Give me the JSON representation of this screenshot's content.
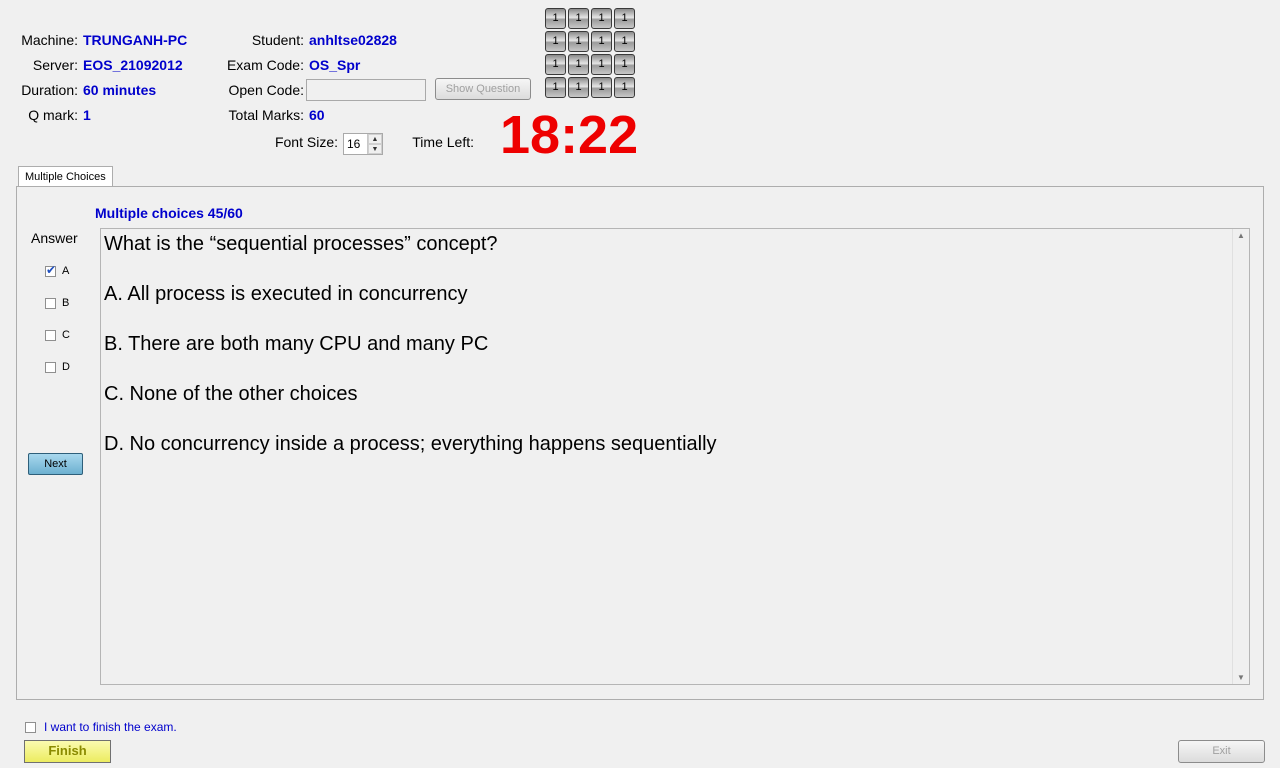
{
  "header": {
    "machine_label": "Machine:",
    "machine_value": "TRUNGANH-PC",
    "server_label": "Server:",
    "server_value": "EOS_21092012",
    "duration_label": "Duration:",
    "duration_value": "60 minutes",
    "qmark_label": "Q mark:",
    "qmark_value": "1",
    "student_label": "Student:",
    "student_value": "anhltse02828",
    "exam_code_label": "Exam Code:",
    "exam_code_value": "OS_Spr",
    "open_code_label": "Open Code:",
    "open_code_value": "",
    "show_question_label": "Show Question",
    "total_marks_label": "Total Marks:",
    "total_marks_value": "60",
    "font_size_label": "Font Size:",
    "font_size_value": "16",
    "time_left_label": "Time Left:",
    "time_left_value": "18:22"
  },
  "grid_buttons": [
    [
      "1",
      "1",
      "1",
      "1"
    ],
    [
      "1",
      "1",
      "1",
      "1"
    ],
    [
      "1",
      "1",
      "1",
      "1"
    ],
    [
      "1",
      "1",
      "1",
      "1"
    ]
  ],
  "tab": {
    "label": "Multiple Choices"
  },
  "question": {
    "progress": "Multiple choices 45/60",
    "answer_label": "Answer",
    "text": "What is the “sequential processes” concept?",
    "choices": [
      "A.  All process is executed in concurrency",
      "B.  There are both many CPU and many PC",
      "C.  None of the other choices",
      "D.  No concurrency inside a process; everything happens sequentially"
    ],
    "options": [
      {
        "letter": "A",
        "checked": true
      },
      {
        "letter": "B",
        "checked": false
      },
      {
        "letter": "C",
        "checked": false
      },
      {
        "letter": "D",
        "checked": false
      }
    ],
    "next_label": "Next"
  },
  "footer": {
    "finish_confirm_label": "I want to finish the exam.",
    "finish_label": "Finish",
    "exit_label": "Exit"
  },
  "colors": {
    "timer": "#ee0000",
    "value_text": "#0000cc",
    "finish_button": "#ecec60"
  }
}
